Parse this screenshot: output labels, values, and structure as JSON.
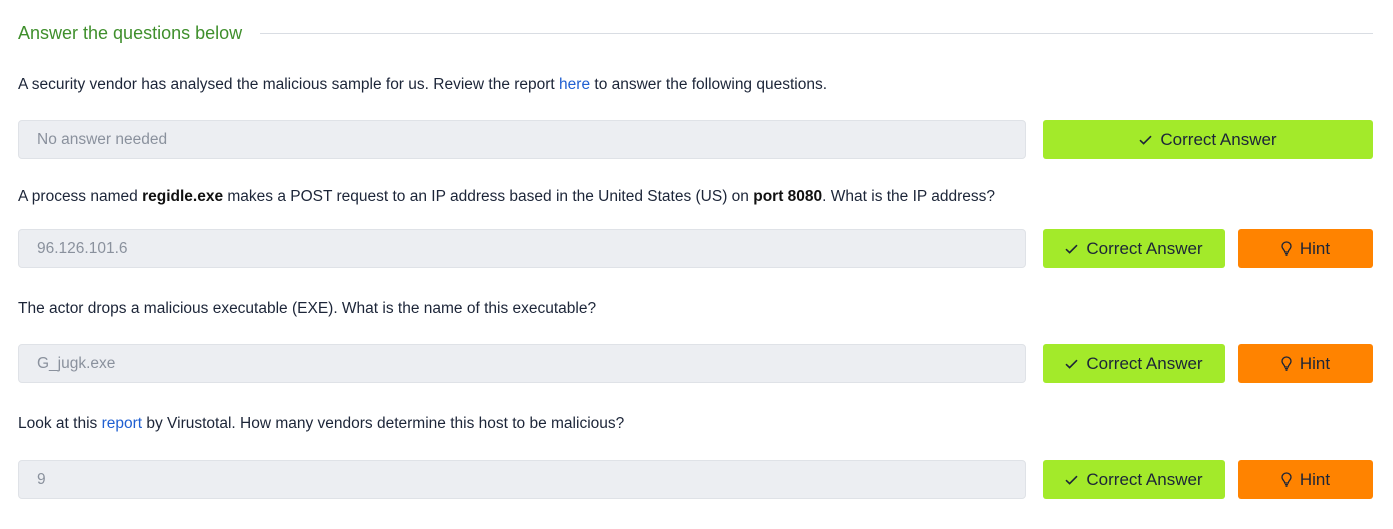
{
  "section": {
    "title": "Answer the questions below"
  },
  "questions": [
    {
      "prefix": "A security vendor has analysed the malicious sample for us. Review the report ",
      "link": "here",
      "suffix": " to answer the following questions.",
      "answer": "No answer needed",
      "correct_label": "Correct Answer"
    },
    {
      "part1": "A process named ",
      "bold1": "regidle.exe",
      "part2": " makes a POST request to an IP address based in the United States (US) on ",
      "bold2": "port 8080",
      "part3": ". What is the IP address?",
      "answer": "96.126.101.6",
      "correct_label": "Correct Answer",
      "hint_label": "Hint"
    },
    {
      "text": "The actor drops a malicious executable (EXE). What is the name of this executable?",
      "answer": "G_jugk.exe",
      "correct_label": "Correct Answer",
      "hint_label": "Hint"
    },
    {
      "prefix": "Look at this ",
      "link": "report",
      "suffix": " by Virustotal. How many vendors determine this host to be malicious?",
      "answer": "9",
      "correct_label": "Correct Answer",
      "hint_label": "Hint"
    }
  ],
  "colors": {
    "section_title": "#3f8f2c",
    "link": "#1f5fd1",
    "correct_button": "#a3ea2a",
    "hint_button": "#ff8300",
    "answer_field_bg": "#eceef2"
  },
  "icons": {
    "correct": "check-icon",
    "hint": "lightbulb-icon"
  }
}
